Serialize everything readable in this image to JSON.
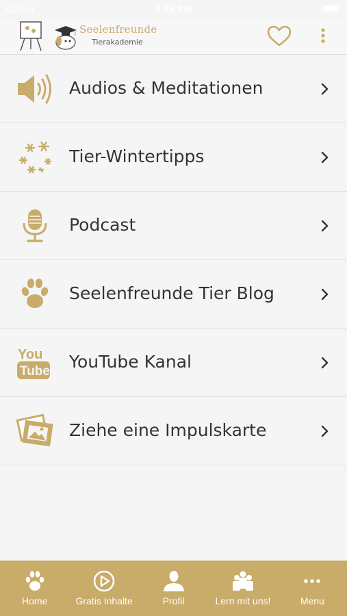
{
  "statusbar": {
    "carrier": "Carrier",
    "time": "2:35 PM"
  },
  "header": {
    "logo_line1": "Seelenfreunde",
    "logo_line2": "Tierakademie"
  },
  "menu_items": [
    {
      "label": "Audios & Meditationen",
      "icon": "speaker-icon"
    },
    {
      "label": "Tier-Wintertipps",
      "icon": "snowflakes-icon"
    },
    {
      "label": "Podcast",
      "icon": "microphone-icon"
    },
    {
      "label": "Seelenfreunde Tier Blog",
      "icon": "paw-icon"
    },
    {
      "label": "YouTube Kanal",
      "icon": "youtube-icon"
    },
    {
      "label": "Ziehe eine Impulskarte",
      "icon": "picture-cards-icon"
    }
  ],
  "tabs": [
    {
      "label": "Home",
      "icon": "paw-icon"
    },
    {
      "label": "Gratis Inhalte",
      "icon": "play-circle-icon"
    },
    {
      "label": "Profil",
      "icon": "person-icon"
    },
    {
      "label": "Lern mit uns!",
      "icon": "group-icon"
    },
    {
      "label": "Menu",
      "icon": "more-horizontal-icon"
    }
  ],
  "colors": {
    "accent": "#c9ab6a",
    "background": "#f5f5f5",
    "text": "#333333",
    "tab_text": "#ffffff"
  }
}
